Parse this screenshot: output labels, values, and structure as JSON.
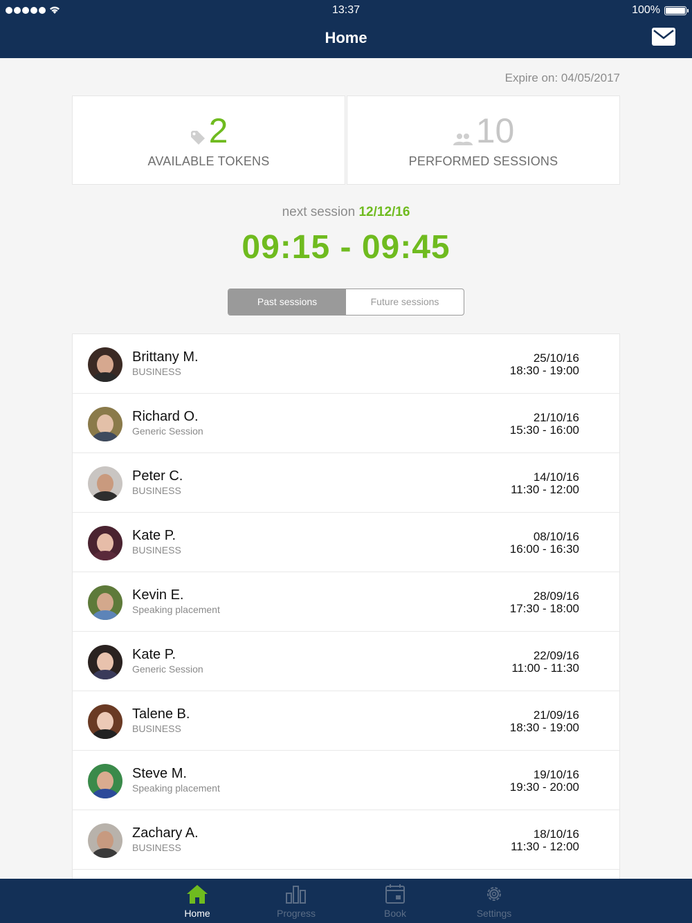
{
  "status_bar": {
    "time": "13:37",
    "battery": "100%"
  },
  "nav": {
    "title": "Home"
  },
  "expire": "Expire on: 04/05/2017",
  "stats": [
    {
      "value": "2",
      "label": "AVAILABLE TOKENS",
      "icon": "tag-icon"
    },
    {
      "value": "10",
      "label": "PERFORMED SESSIONS",
      "icon": "people-icon"
    }
  ],
  "next_session": {
    "prefix": "next session",
    "date": "12/12/16",
    "time_range": "09:15 - 09:45"
  },
  "segment": {
    "past": "Past sessions",
    "future": "Future sessions",
    "selected": "past"
  },
  "sessions": [
    {
      "name": "Brittany M.",
      "subject": "BUSINESS",
      "date": "25/10/16",
      "hours": "18:30 - 19:00"
    },
    {
      "name": "Richard O.",
      "subject": "Generic Session",
      "date": "21/10/16",
      "hours": "15:30 - 16:00"
    },
    {
      "name": "Peter C.",
      "subject": "BUSINESS",
      "date": "14/10/16",
      "hours": "11:30 - 12:00"
    },
    {
      "name": "Kate P.",
      "subject": "BUSINESS",
      "date": "08/10/16",
      "hours": "16:00 - 16:30"
    },
    {
      "name": "Kevin E.",
      "subject": "Speaking placement",
      "date": "28/09/16",
      "hours": "17:30 - 18:00"
    },
    {
      "name": "Kate P.",
      "subject": "Generic Session",
      "date": "22/09/16",
      "hours": "11:00 - 11:30"
    },
    {
      "name": "Talene B.",
      "subject": "BUSINESS",
      "date": "21/09/16",
      "hours": "18:30 - 19:00"
    },
    {
      "name": "Steve M.",
      "subject": "Speaking placement",
      "date": "19/10/16",
      "hours": "19:30 - 20:00"
    },
    {
      "name": "Zachary A.",
      "subject": "BUSINESS",
      "date": "18/10/16",
      "hours": "11:30 - 12:00"
    }
  ],
  "tabs": [
    {
      "label": "Home",
      "icon": "home-icon",
      "active": true
    },
    {
      "label": "Progress",
      "icon": "bar-chart-icon",
      "active": false
    },
    {
      "label": "Book",
      "icon": "calendar-icon",
      "active": false
    },
    {
      "label": "Settings",
      "icon": "gear-icon",
      "active": false
    }
  ],
  "colors": {
    "nav": "#133057",
    "accent": "#6fbb1f",
    "muted": "#8c8c8c"
  }
}
